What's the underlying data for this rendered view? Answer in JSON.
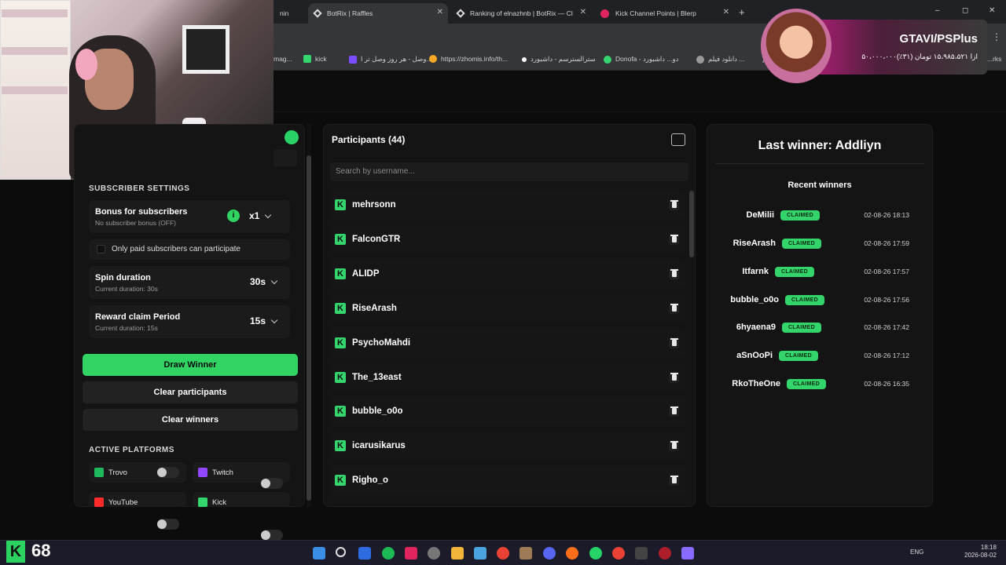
{
  "browser": {
    "tabs": [
      {
        "label": "BotRix | Raffles",
        "active": true
      },
      {
        "label": "Ranking of elnazhnb | BotRix — Cl",
        "active": false
      },
      {
        "label": "Kick Channel Points | Blerp",
        "active": false
      }
    ],
    "partial_tab": "nin",
    "new_tab": "+",
    "bookmarks": [
      "mag...",
      "kick",
      "وصل - هر روز وصل تر ا...",
      "https://zhomis.info/th...",
      "سترالسترسم - داشبورد",
      "Donofa - دو... داشبورد",
      "دانلود فیلم ...",
      "لم",
      "...rks"
    ],
    "window_controls": {
      "minimize": "–",
      "maximize": "◻",
      "close": "✕"
    },
    "menu": "⋮"
  },
  "ad": {
    "title": "GTAVI/PSPlus",
    "subtitle": "۵۰،۰۰۰،۰۰۰ازا ۱۵،۹۸۵،۵۲۱ تومان (۳۱٪)"
  },
  "settings": {
    "section_title": "SUBSCRIBER SETTINGS",
    "bonus": {
      "label": "Bonus for subscribers",
      "sub": "No subscriber bonus (OFF)",
      "value": "x1"
    },
    "only_paid": "Only paid subscribers can participate",
    "spin": {
      "label": "Spin duration",
      "sub": "Current duration: 30s",
      "value": "30s"
    },
    "claim": {
      "label": "Reward claim Period",
      "sub": "Current duration: 15s",
      "value": "15s"
    },
    "draw_button": "Draw Winner",
    "clear_participants": "Clear participants",
    "clear_winners": "Clear winners",
    "platforms_title": "ACTIVE PLATFORMS",
    "platforms": [
      {
        "name": "Trovo",
        "color": "#1fb85c"
      },
      {
        "name": "Twitch",
        "color": "#9146ff"
      },
      {
        "name": "YouTube",
        "color": "#ff2b2b"
      },
      {
        "name": "Kick",
        "color": "#35d66e"
      }
    ]
  },
  "participants": {
    "title": "Participants (44)",
    "search_placeholder": "Search by username...",
    "items": [
      "mehrsonn",
      "FalconGTR",
      "ALIDP",
      "RiseArash",
      "PsychoMahdi",
      "The_13east",
      "bubble_o0o",
      "icarusikarus",
      "Righo_o"
    ]
  },
  "winners": {
    "last_winner": "Last winner: Addliyn",
    "recent_title": "Recent winners",
    "badge": "CLAIMED",
    "items": [
      {
        "name": "DeMilii",
        "date": "02-08-26 18:13"
      },
      {
        "name": "RiseArash",
        "date": "02-08-26 17:59"
      },
      {
        "name": "Itfarnk",
        "date": "02-08-26 17:57"
      },
      {
        "name": "bubble_o0o",
        "date": "02-08-26 17:56"
      },
      {
        "name": "6hyaena9",
        "date": "02-08-26 17:42"
      },
      {
        "name": "aSnOoPi",
        "date": "02-08-26 17:12"
      },
      {
        "name": "RkoTheOne",
        "date": "02-08-26 16:35"
      }
    ]
  },
  "overlay_counter": "68",
  "taskbar": {
    "lang": "ENG",
    "time": "18:18",
    "date": "2026-08-02"
  },
  "colors": {
    "accent": "#31d363",
    "bg": "#0c0c0c",
    "panel": "#141414"
  }
}
